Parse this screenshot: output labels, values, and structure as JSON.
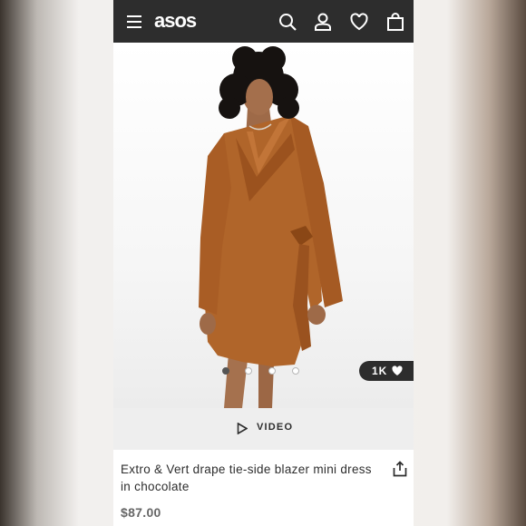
{
  "header": {
    "logo": "asos",
    "icons": [
      "menu-icon",
      "search-icon",
      "account-icon",
      "heart-icon",
      "bag-icon"
    ]
  },
  "gallery": {
    "image_alt": "Model wearing chocolate drape tie-side blazer mini dress",
    "dress_color": "#b0652a",
    "dots_total": 4,
    "active_dot": 1,
    "likes": "1K"
  },
  "video": {
    "label": "VIDEO"
  },
  "product": {
    "title": "Extro & Vert drape tie-side blazer mini dress in chocolate",
    "price": "$87.00"
  },
  "colors": {
    "header_bg": "#2d2d2d",
    "price": "#666666"
  }
}
